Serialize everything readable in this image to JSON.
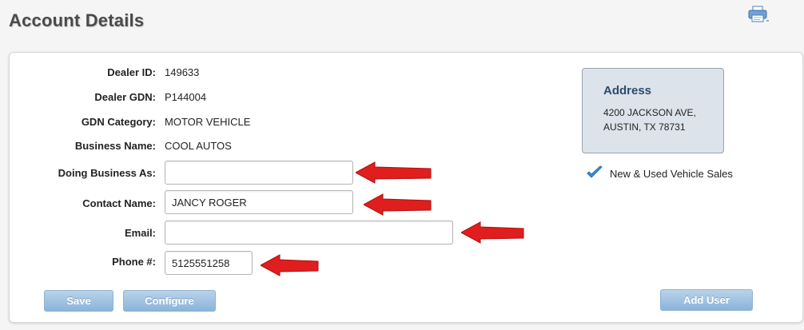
{
  "page": {
    "title": "Account Details"
  },
  "toolbar": {
    "print_icon": "printer-icon"
  },
  "details": {
    "dealer_id": {
      "label": "Dealer ID:",
      "value": "149633"
    },
    "dealer_gdn": {
      "label": "Dealer GDN:",
      "value": "P144004"
    },
    "gdn_category": {
      "label": "GDN Category:",
      "value": "MOTOR VEHICLE"
    },
    "business_name": {
      "label": "Business Name:",
      "value": "COOL AUTOS"
    }
  },
  "form": {
    "doing_business_as": {
      "label": "Doing Business As:",
      "value": ""
    },
    "contact_name": {
      "label": "Contact Name:",
      "value": "JANCY ROGER"
    },
    "email": {
      "label": "Email:",
      "value": ""
    },
    "phone": {
      "label": "Phone #:",
      "value": "5125551258"
    }
  },
  "address": {
    "title": "Address",
    "line1": "4200 JACKSON AVE,",
    "line2": "AUSTIN, TX 78731"
  },
  "services": [
    {
      "label": "New & Used Vehicle Sales",
      "icon": "checkmark-icon",
      "checked": true
    }
  ],
  "buttons": {
    "save": "Save",
    "configure": "Configure",
    "add_user": "Add User"
  },
  "colors": {
    "arrow": "#e01e1e",
    "button": "#8ab4da",
    "address_bg": "#dde3ea",
    "address_title": "#2c4a6e",
    "check": "#3a8fd6"
  }
}
